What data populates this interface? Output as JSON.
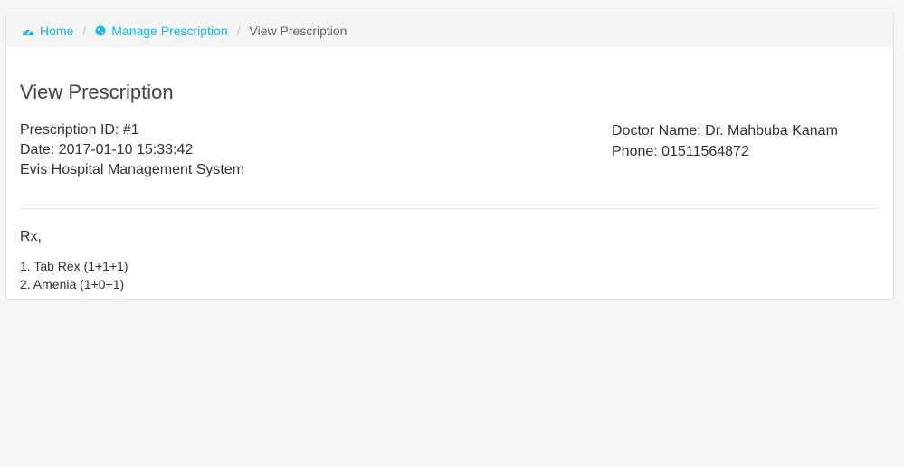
{
  "breadcrumb": {
    "home": {
      "label": "Home",
      "icon": "dashboard-icon"
    },
    "manage": {
      "label": "Manage Prescription",
      "icon": "globe-icon"
    },
    "current": {
      "label": "View Prescription"
    },
    "separator": "/"
  },
  "page_title": "View Prescription",
  "prescription": {
    "id_line": "Prescription ID: #1",
    "date_line": "Date: 2017-01-10 15:33:42",
    "org_line": "Evis Hospital Management System"
  },
  "doctor": {
    "name_line": "Doctor Name: Dr. Mahbuba Kanam",
    "phone_line": "Phone: 01511564872"
  },
  "rx": {
    "label": "Rx,",
    "items": [
      "1. Tab Rex (1+1+1)",
      "2. Amenia (1+0+1)"
    ]
  },
  "colors": {
    "link": "#1ab7ea",
    "breadcrumb_bg": "#f5f5f5",
    "page_bg": "#f6f6f6"
  }
}
